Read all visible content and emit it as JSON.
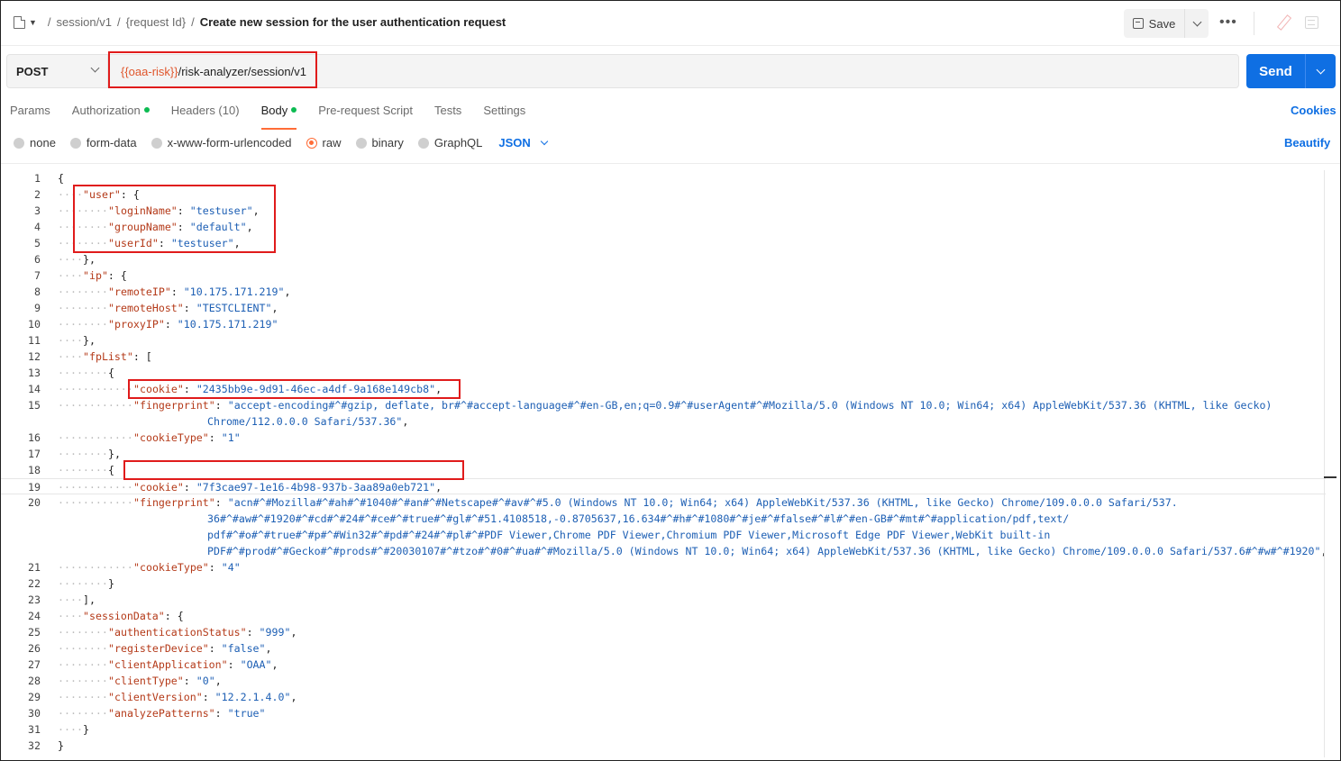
{
  "breadcrumb": {
    "parts": [
      "session/v1",
      "{request Id}"
    ],
    "title": "Create new session for the user authentication request"
  },
  "toolbar": {
    "save_label": "Save",
    "more_label": "•••"
  },
  "request": {
    "method": "POST",
    "url_variable": "{{oaa-risk}}",
    "url_path": "/risk-analyzer/session/v1",
    "send_label": "Send"
  },
  "tabs": [
    {
      "label": "Params",
      "dot": false
    },
    {
      "label": "Authorization",
      "dot": true
    },
    {
      "label": "Headers (10)",
      "dot": false
    },
    {
      "label": "Body",
      "dot": true,
      "active": true
    },
    {
      "label": "Pre-request Script",
      "dot": false
    },
    {
      "label": "Tests",
      "dot": false
    },
    {
      "label": "Settings",
      "dot": false
    }
  ],
  "cookies_label": "Cookies",
  "body_types": [
    {
      "label": "none",
      "selected": false
    },
    {
      "label": "form-data",
      "selected": false
    },
    {
      "label": "x-www-form-urlencoded",
      "selected": false
    },
    {
      "label": "raw",
      "selected": true
    },
    {
      "label": "binary",
      "selected": false
    },
    {
      "label": "GraphQL",
      "selected": false
    }
  ],
  "format_label": "JSON",
  "beautify_label": "Beautify",
  "colors": {
    "accent": "#0f6fe3",
    "tab_indicator": "#ff6c37",
    "variable": "#e0562c",
    "highlight": "#e01b1b",
    "dot": "#0cbb52"
  },
  "code_lines": [
    {
      "n": "1",
      "indent": 0,
      "segs": [
        [
          "p",
          "{"
        ]
      ]
    },
    {
      "n": "2",
      "indent": 1,
      "segs": [
        [
          "k",
          "\"user\""
        ],
        [
          "p",
          ": {"
        ]
      ]
    },
    {
      "n": "3",
      "indent": 2,
      "segs": [
        [
          "k",
          "\"loginName\""
        ],
        [
          "p",
          ": "
        ],
        [
          "s",
          "\"testuser\""
        ],
        [
          "p",
          ","
        ]
      ]
    },
    {
      "n": "4",
      "indent": 2,
      "segs": [
        [
          "k",
          "\"groupName\""
        ],
        [
          "p",
          ": "
        ],
        [
          "s",
          "\"default\""
        ],
        [
          "p",
          ","
        ]
      ]
    },
    {
      "n": "5",
      "indent": 2,
      "segs": [
        [
          "k",
          "\"userId\""
        ],
        [
          "p",
          ": "
        ],
        [
          "s",
          "\"testuser\""
        ],
        [
          "p",
          ","
        ]
      ]
    },
    {
      "n": "6",
      "indent": 1,
      "segs": [
        [
          "p",
          "},"
        ]
      ]
    },
    {
      "n": "7",
      "indent": 1,
      "segs": [
        [
          "k",
          "\"ip\""
        ],
        [
          "p",
          ": {"
        ]
      ]
    },
    {
      "n": "8",
      "indent": 2,
      "segs": [
        [
          "k",
          "\"remoteIP\""
        ],
        [
          "p",
          ": "
        ],
        [
          "s",
          "\"10.175.171.219\""
        ],
        [
          "p",
          ","
        ]
      ]
    },
    {
      "n": "9",
      "indent": 2,
      "segs": [
        [
          "k",
          "\"remoteHost\""
        ],
        [
          "p",
          ": "
        ],
        [
          "s",
          "\"TESTCLIENT\""
        ],
        [
          "p",
          ","
        ]
      ]
    },
    {
      "n": "10",
      "indent": 2,
      "segs": [
        [
          "k",
          "\"proxyIP\""
        ],
        [
          "p",
          ": "
        ],
        [
          "s",
          "\"10.175.171.219\""
        ]
      ]
    },
    {
      "n": "11",
      "indent": 1,
      "segs": [
        [
          "p",
          "},"
        ]
      ]
    },
    {
      "n": "12",
      "indent": 1,
      "segs": [
        [
          "k",
          "\"fpList\""
        ],
        [
          "p",
          ": ["
        ]
      ]
    },
    {
      "n": "13",
      "indent": 2,
      "segs": [
        [
          "p",
          "{"
        ]
      ]
    },
    {
      "n": "14",
      "indent": 3,
      "segs": [
        [
          "k",
          "\"cookie\""
        ],
        [
          "p",
          ": "
        ],
        [
          "s",
          "\"2435bb9e-9d91-46ec-a4df-9a168e149cb8\""
        ],
        [
          "p",
          ","
        ]
      ]
    },
    {
      "n": "15",
      "indent": 3,
      "segs": [
        [
          "k",
          "\"fingerprint\""
        ],
        [
          "p",
          ": "
        ],
        [
          "s",
          "\"accept-encoding#^#gzip, deflate, br#^#accept-language#^#en-GB,en;q=0.9#^#userAgent#^#Mozilla/5.0 (Windows NT 10.0; Win64; x64) AppleWebKit/537.36 (KHTML, like Gecko)"
        ]
      ]
    },
    {
      "n": "",
      "indent": 4,
      "wrap": true,
      "segs": [
        [
          "s",
          "Chrome/112.0.0.0 Safari/537.36\""
        ],
        [
          "p",
          ","
        ]
      ]
    },
    {
      "n": "16",
      "indent": 3,
      "segs": [
        [
          "k",
          "\"cookieType\""
        ],
        [
          "p",
          ": "
        ],
        [
          "s",
          "\"1\""
        ]
      ]
    },
    {
      "n": "17",
      "indent": 2,
      "segs": [
        [
          "p",
          "},"
        ]
      ]
    },
    {
      "n": "18",
      "indent": 2,
      "segs": [
        [
          "p",
          "{"
        ]
      ]
    },
    {
      "n": "19",
      "indent": 3,
      "segs": [
        [
          "k",
          "\"cookie\""
        ],
        [
          "p",
          ": "
        ],
        [
          "s",
          "\"7f3cae97-1e16-4b98-937b-3aa89a0eb721\""
        ],
        [
          "p",
          ","
        ]
      ]
    },
    {
      "n": "20",
      "indent": 3,
      "segs": [
        [
          "k",
          "\"fingerprint\""
        ],
        [
          "p",
          ": "
        ],
        [
          "s",
          "\"acn#^#Mozilla#^#ah#^#1040#^#an#^#Netscape#^#av#^#5.0 (Windows NT 10.0; Win64; x64) AppleWebKit/537.36 (KHTML, like Gecko) Chrome/109.0.0.0 Safari/537."
        ]
      ]
    },
    {
      "n": "",
      "indent": 4,
      "wrap": true,
      "segs": [
        [
          "s",
          "36#^#aw#^#1920#^#cd#^#24#^#ce#^#true#^#gl#^#51.4108518,-0.8705637,16.634#^#h#^#1080#^#je#^#false#^#l#^#en-GB#^#mt#^#application/pdf,text/"
        ]
      ]
    },
    {
      "n": "",
      "indent": 4,
      "wrap": true,
      "segs": [
        [
          "s",
          "pdf#^#o#^#true#^#p#^#Win32#^#pd#^#24#^#pl#^#PDF Viewer,Chrome PDF Viewer,Chromium PDF Viewer,Microsoft Edge PDF Viewer,WebKit built-in"
        ]
      ]
    },
    {
      "n": "",
      "indent": 4,
      "wrap": true,
      "segs": [
        [
          "s",
          "PDF#^#prod#^#Gecko#^#prods#^#20030107#^#tzo#^#0#^#ua#^#Mozilla/5.0 (Windows NT 10.0; Win64; x64) AppleWebKit/537.36 (KHTML, like Gecko) Chrome/109.0.0.0 Safari/537.6#^#w#^#1920\""
        ],
        [
          "p",
          ","
        ]
      ]
    },
    {
      "n": "21",
      "indent": 3,
      "segs": [
        [
          "k",
          "\"cookieType\""
        ],
        [
          "p",
          ": "
        ],
        [
          "s",
          "\"4\""
        ]
      ]
    },
    {
      "n": "22",
      "indent": 2,
      "segs": [
        [
          "p",
          "}"
        ]
      ]
    },
    {
      "n": "23",
      "indent": 1,
      "segs": [
        [
          "p",
          "],"
        ]
      ]
    },
    {
      "n": "24",
      "indent": 1,
      "segs": [
        [
          "k",
          "\"sessionData\""
        ],
        [
          "p",
          ": {"
        ]
      ]
    },
    {
      "n": "25",
      "indent": 2,
      "segs": [
        [
          "k",
          "\"authenticationStatus\""
        ],
        [
          "p",
          ": "
        ],
        [
          "s",
          "\"999\""
        ],
        [
          "p",
          ","
        ]
      ]
    },
    {
      "n": "26",
      "indent": 2,
      "segs": [
        [
          "k",
          "\"registerDevice\""
        ],
        [
          "p",
          ": "
        ],
        [
          "s",
          "\"false\""
        ],
        [
          "p",
          ","
        ]
      ]
    },
    {
      "n": "27",
      "indent": 2,
      "segs": [
        [
          "k",
          "\"clientApplication\""
        ],
        [
          "p",
          ": "
        ],
        [
          "s",
          "\"OAA\""
        ],
        [
          "p",
          ","
        ]
      ]
    },
    {
      "n": "28",
      "indent": 2,
      "segs": [
        [
          "k",
          "\"clientType\""
        ],
        [
          "p",
          ": "
        ],
        [
          "s",
          "\"0\""
        ],
        [
          "p",
          ","
        ]
      ]
    },
    {
      "n": "29",
      "indent": 2,
      "segs": [
        [
          "k",
          "\"clientVersion\""
        ],
        [
          "p",
          ": "
        ],
        [
          "s",
          "\"12.2.1.4.0\""
        ],
        [
          "p",
          ","
        ]
      ]
    },
    {
      "n": "30",
      "indent": 2,
      "segs": [
        [
          "k",
          "\"analyzePatterns\""
        ],
        [
          "p",
          ": "
        ],
        [
          "s",
          "\"true\""
        ]
      ]
    },
    {
      "n": "31",
      "indent": 1,
      "segs": [
        [
          "p",
          "}"
        ]
      ]
    },
    {
      "n": "32",
      "indent": 0,
      "segs": [
        [
          "p",
          "}"
        ]
      ]
    }
  ]
}
